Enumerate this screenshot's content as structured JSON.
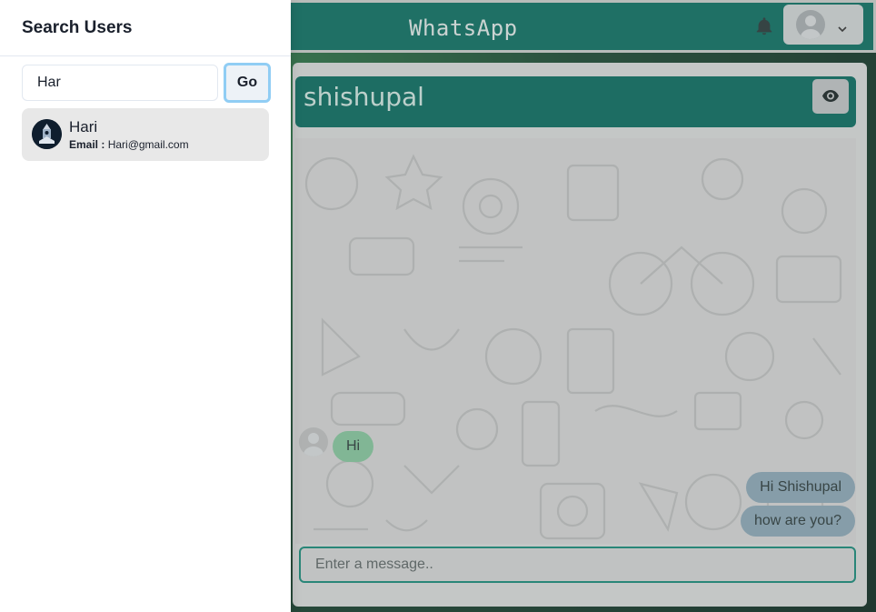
{
  "app": {
    "brand": "WhatsApp"
  },
  "chat": {
    "title": "shishupal",
    "messages": [
      {
        "text": "Hi",
        "side": "left"
      },
      {
        "text": "Hi Shishupal",
        "side": "right"
      },
      {
        "text": "how are you?",
        "side": "right"
      }
    ],
    "input_placeholder": "Enter a message.."
  },
  "drawer": {
    "title": "Search Users",
    "search_value": "Har",
    "go_label": "Go",
    "results": [
      {
        "name": "Hari",
        "email_label": "Email :",
        "email": "Hari@gmail.com"
      }
    ]
  },
  "colors": {
    "header": "#0e6f62",
    "chat_header": "#0c6c60",
    "bubble_received": "#86c59d",
    "bubble_sent": "#8ba6b5",
    "input_border": "#1a8a79",
    "go_focus": "#90cdf4"
  },
  "icons": [
    "bell-icon",
    "avatar-icon",
    "chevron-down-icon",
    "eye-icon",
    "user-avatar-icon"
  ]
}
